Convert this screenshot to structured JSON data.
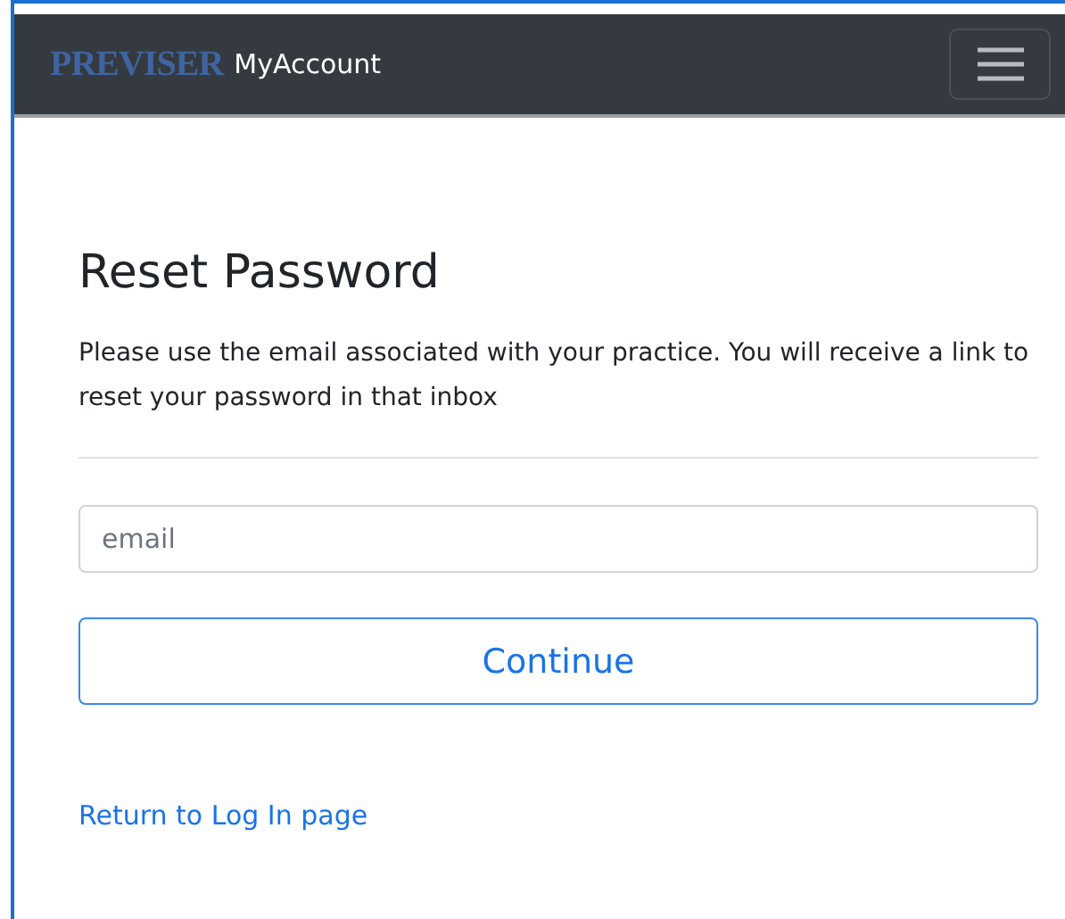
{
  "navbar": {
    "logo": "PREVISER",
    "title": "MyAccount"
  },
  "heading": "Reset Password",
  "instructions": "Please use the email associated with your practice. You will receive a link to reset your password in that inbox",
  "email": {
    "placeholder": "email"
  },
  "submit": "Continue",
  "return_link": "Return to Log In page"
}
